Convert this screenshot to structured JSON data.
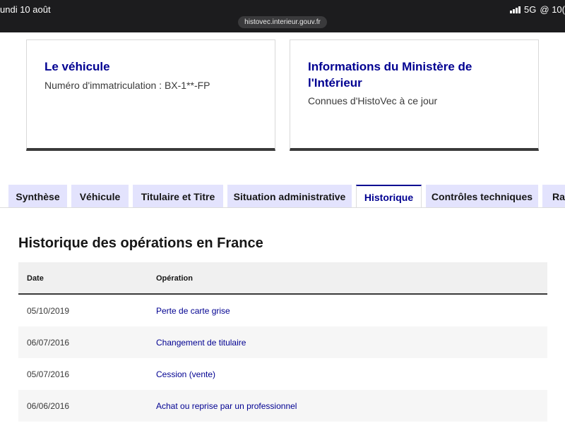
{
  "status_bar": {
    "date": "undi 10 août",
    "network": "5G",
    "extra": "@ 10(",
    "url": "histovec.interieur.gouv.fr"
  },
  "cards": {
    "vehicle": {
      "title": "Le véhicule",
      "text": "Numéro d'immatriculation : BX-1**-FP"
    },
    "ministry": {
      "title": "Informations du Ministère de l'Intérieur",
      "text": "Connues d'HistoVec à ce jour"
    }
  },
  "tabs": [
    {
      "label": "Synthèse"
    },
    {
      "label": "Véhicule"
    },
    {
      "label": "Titulaire et Titre"
    },
    {
      "label": "Situation administrative"
    },
    {
      "label": "Historique"
    },
    {
      "label": "Contrôles techniques"
    },
    {
      "label": "Ra"
    }
  ],
  "active_tab": "Historique",
  "history": {
    "title": "Historique des opérations en France",
    "columns": {
      "date": "Date",
      "operation": "Opération"
    },
    "rows": [
      {
        "date": "05/10/2019",
        "operation": "Perte de carte grise"
      },
      {
        "date": "06/07/2016",
        "operation": "Changement de titulaire"
      },
      {
        "date": "05/07/2016",
        "operation": "Cession (vente)"
      },
      {
        "date": "06/06/2016",
        "operation": "Achat ou reprise par un professionnel"
      }
    ]
  },
  "colors": {
    "accent": "#000091",
    "tab_bg": "#e3e3fd",
    "status_bar_bg": "#1c1c1e"
  }
}
